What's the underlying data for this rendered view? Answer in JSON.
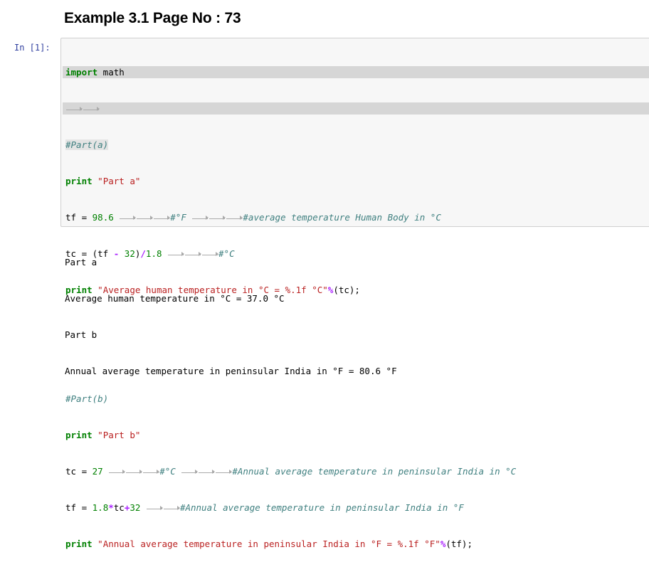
{
  "heading": "Example 3.1 Page No : 73",
  "prompt": "In [1]:",
  "code": {
    "l1": {
      "kw": "import",
      "rest": " math"
    },
    "l3": "#Part(a)",
    "l4": {
      "kw": "print",
      "str": "\"Part a\""
    },
    "l5": {
      "a": "tf = ",
      "num": "98.6",
      "c1": "#°F",
      "c2": "#average temperature Human Body in °C"
    },
    "l6": {
      "a": "tc = (tf ",
      "op1": "-",
      "b": " ",
      "num": "32",
      "c": ")",
      "op2": "/",
      "num2": "1.8",
      "cmt": "#°C"
    },
    "l7": {
      "kw": "print",
      "str": "\"Average human temperature in °C = %.1f °C\"",
      "op": "%",
      "rest": "(tc);"
    },
    "l10": "#Part(b)",
    "l11": {
      "kw": "print",
      "str": "\"Part b\""
    },
    "l12": {
      "a": "tc = ",
      "num": "27",
      "c1": "#°C",
      "c2": "#Annual average temperature in peninsular India in °C"
    },
    "l13": {
      "a": "tf = ",
      "num": "1.8",
      "op1": "*",
      "b": "tc",
      "op2": "+",
      "num2": "32",
      "cmt": "#Annual average temperature in peninsular India in °F"
    },
    "l14": {
      "kw": "print",
      "str": "\"Annual average temperature in peninsular India in °F = %.1f °F\"",
      "op": "%",
      "rest": "(tf);"
    }
  },
  "output": [
    "Part a",
    "Average human temperature in °C = 37.0 °C",
    "Part b",
    "Annual average temperature in peninsular India in °F = 80.6 °F"
  ]
}
